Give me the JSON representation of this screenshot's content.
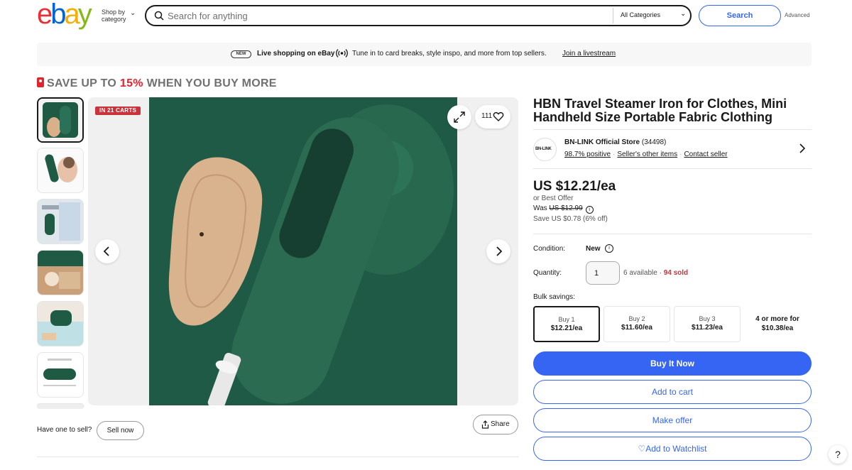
{
  "header": {
    "logo_letters": [
      "e",
      "b",
      "a",
      "y"
    ],
    "logo_colors": [
      "#e53238",
      "#0064d2",
      "#f5af02",
      "#86b817"
    ],
    "shop_by_line1": "Shop by",
    "shop_by_line2": "category",
    "search_placeholder": "Search for anything",
    "category": "All Categories",
    "search_button": "Search",
    "advanced": "Advanced"
  },
  "banner": {
    "badge": "NEW",
    "headline": "Live shopping on eBay",
    "text": "Tune in to card breaks, style inspo, and more from top sellers.",
    "link": "Join a livestream"
  },
  "promo": {
    "prefix": "SAVE UP TO ",
    "percent": "15%",
    "suffix": " WHEN YOU BUY MORE"
  },
  "gallery": {
    "carts_badge": "IN 21 CARTS",
    "watch_count": "111",
    "have_one": "Have one to sell?",
    "sell_now": "Sell now",
    "share": "Share"
  },
  "product": {
    "title": "HBN Travel Steamer Iron for Clothes, Mini Handheld Size Portable Fabric Clothing",
    "seller": {
      "logo_text": "BN-LINK",
      "name": "BN-LINK Official Store",
      "feedback": "(34498)",
      "positive": "98.7% positive",
      "other_items": "Seller's other items",
      "contact": "Contact seller"
    },
    "price": "US $12.21/ea",
    "best_offer": "or Best Offer",
    "was_label": "Was ",
    "was_price": "US $12.99",
    "save": "Save US $0.78 (6% off)",
    "condition_label": "Condition:",
    "condition_value": "New",
    "quantity_label": "Quantity:",
    "quantity_value": "1",
    "available": "6 available · ",
    "sold": "94 sold",
    "bulk_label": "Bulk savings:",
    "bulk": [
      {
        "qty": "Buy 1",
        "price": "$12.21/ea"
      },
      {
        "qty": "Buy 2",
        "price": "$11.60/ea"
      },
      {
        "qty": "Buy 3",
        "price": "$11.23/ea"
      }
    ],
    "bulk_more_line1": "4 or more for",
    "bulk_more_line2": "$10.38/ea",
    "buy_now": "Buy It Now",
    "add_cart": "Add to cart",
    "make_offer": "Make offer",
    "watchlist": "Add to Watchlist"
  },
  "help": "?"
}
